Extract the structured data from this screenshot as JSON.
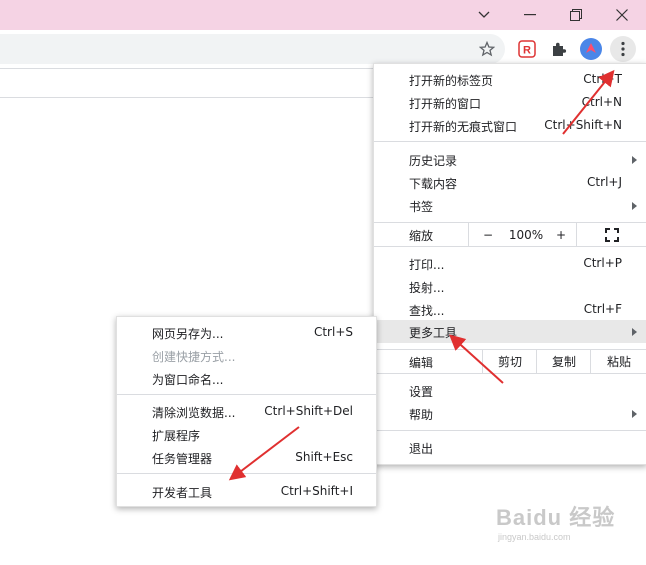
{
  "colors": {
    "titlebar": "#f5d3e4",
    "arrow": "#e03030",
    "highlight": "#e8e8e8",
    "profile": "#4a86e8"
  },
  "toolbar": {
    "star_icon": "star-icon",
    "ext1_icon": "extension-r-icon",
    "puzzle_icon": "puzzle-icon",
    "profile_icon": "profile-avatar-icon",
    "menu_icon": "kebab-menu-icon"
  },
  "menu": {
    "new_tab": {
      "label": "打开新的标签页",
      "shortcut": "Ctrl+T"
    },
    "new_window": {
      "label": "打开新的窗口",
      "shortcut": "Ctrl+N"
    },
    "incognito": {
      "label": "打开新的无痕式窗口",
      "shortcut": "Ctrl+Shift+N"
    },
    "history": {
      "label": "历史记录"
    },
    "downloads": {
      "label": "下载内容",
      "shortcut": "Ctrl+J"
    },
    "bookmarks": {
      "label": "书签"
    },
    "zoom": {
      "label": "缩放",
      "minus": "−",
      "value": "100%",
      "plus": "+"
    },
    "print": {
      "label": "打印...",
      "shortcut": "Ctrl+P"
    },
    "cast": {
      "label": "投射..."
    },
    "find": {
      "label": "查找...",
      "shortcut": "Ctrl+F"
    },
    "more_tools": {
      "label": "更多工具"
    },
    "edit": {
      "label": "编辑",
      "cut": "剪切",
      "copy": "复制",
      "paste": "粘贴"
    },
    "settings": {
      "label": "设置"
    },
    "help": {
      "label": "帮助"
    },
    "exit": {
      "label": "退出"
    }
  },
  "submenu": {
    "save_as": {
      "label": "网页另存为...",
      "shortcut": "Ctrl+S"
    },
    "create_shortcut": {
      "label": "创建快捷方式..."
    },
    "name_window": {
      "label": "为窗口命名..."
    },
    "clear_data": {
      "label": "清除浏览数据...",
      "shortcut": "Ctrl+Shift+Del"
    },
    "extensions": {
      "label": "扩展程序"
    },
    "task_manager": {
      "label": "任务管理器",
      "shortcut": "Shift+Esc"
    },
    "devtools": {
      "label": "开发者工具",
      "shortcut": "Ctrl+Shift+I"
    }
  },
  "watermark": {
    "main": "Baidu 经验",
    "sub": "jingyan.baidu.com"
  }
}
